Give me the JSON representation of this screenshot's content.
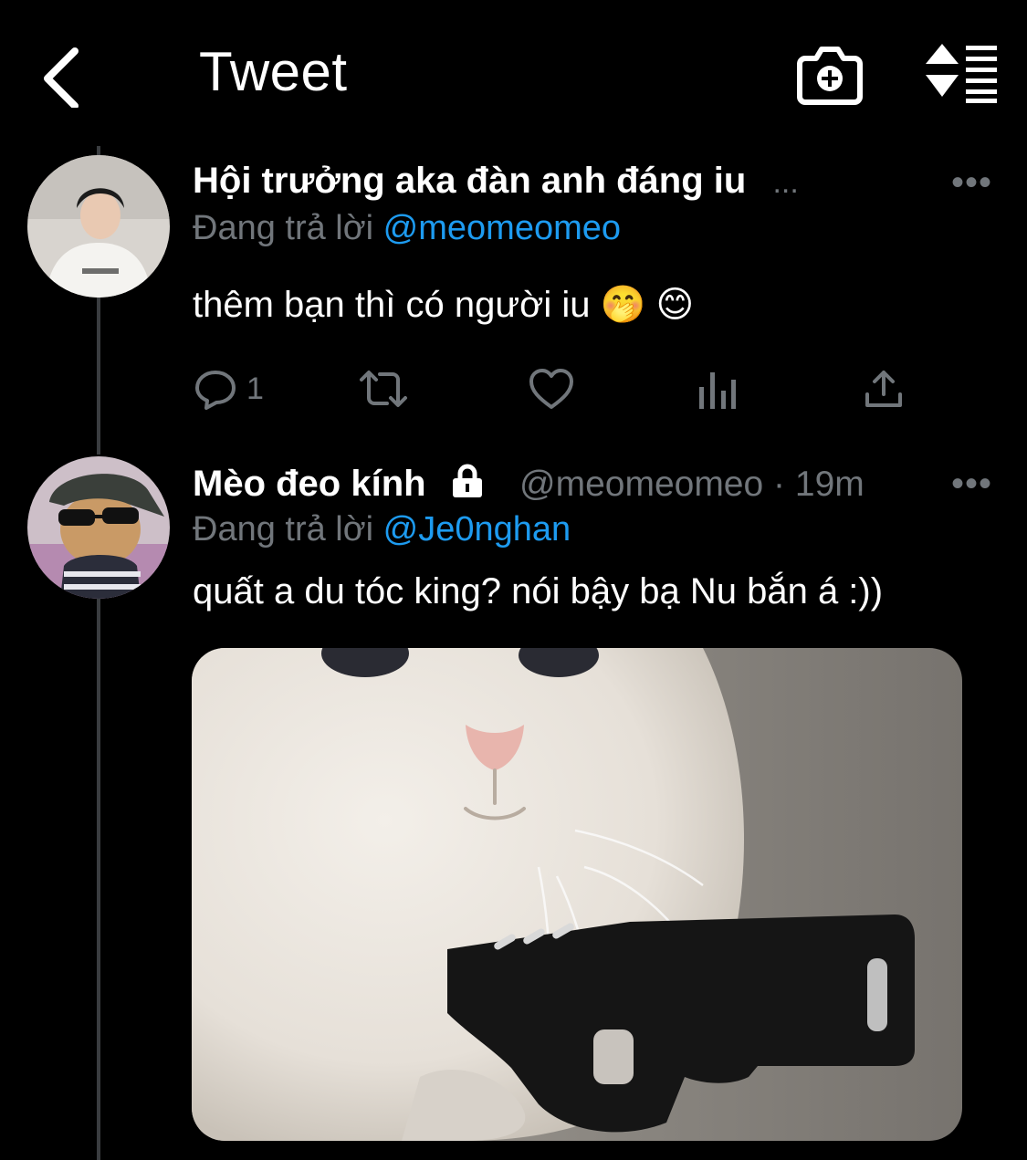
{
  "header": {
    "title": "Tweet"
  },
  "tweets": [
    {
      "display_name": "Hội trưởng aka đàn anh đáng iu",
      "name_overflow": "...",
      "replying_prefix": "Đang trả lời",
      "replying_to": "@meomeomeo",
      "text": "thêm bạn thì có người iu 🤭 😊",
      "more": "•••",
      "reply_count": "1"
    },
    {
      "display_name": "Mèo đeo kính",
      "handle": "@meomeomeo",
      "separator": "·",
      "time": "19m",
      "replying_prefix": "Đang trả lời",
      "replying_to": "@Je0nghan",
      "text": "quất a du tóc king? nói bậy bạ Nu bắn á :))",
      "more": "•••"
    }
  ],
  "colors": {
    "background": "#000000",
    "primary_text": "#ffffff",
    "muted": "#71767b",
    "accent": "#1d9bf0"
  },
  "icons": [
    "back-icon",
    "camera-plus-icon",
    "sort-icon",
    "more-icon",
    "reply-icon",
    "retweet-icon",
    "like-icon",
    "analytics-icon",
    "share-icon",
    "lock-icon"
  ]
}
